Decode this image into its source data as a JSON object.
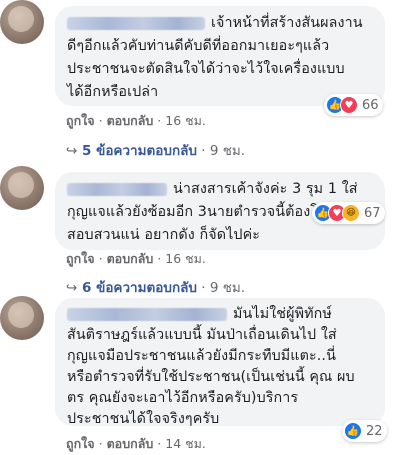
{
  "comments": [
    {
      "name_redacted": true,
      "text_lines": [
        "เจ้าหน้าที่สร้างสันผลงาน",
        "ดีๆอีกแล้วคับท่านดีคับดีที่ออกมาเยอะๆแล้ว",
        "ประชาชนจะตัดสินใจได้ว่าจะไว้ใจเครื่องแบบ",
        "ได้อีกหรือเปล่า"
      ],
      "reactions": [
        "like-icon",
        "love-icon"
      ],
      "reaction_count": "66",
      "like": "ถูกใจ",
      "reply": "ตอบกลับ",
      "time": "16 ชม.",
      "replies_label": "5 ข้อความตอบกลับ",
      "replies_time": "9 ชม."
    },
    {
      "name_redacted": true,
      "text_lines": [
        "น่าสงสารเค้าจังค่ะ 3 รุม 1 ใส่",
        "กุญแจแล้วยังซ้อมอีก 3นายตำรวจนี้ต้องโดน",
        "สอบสวนแน่ อยากดัง ก็จัดไปค่ะ"
      ],
      "reactions": [
        "like-icon",
        "love-icon",
        "haha-icon"
      ],
      "reaction_count": "67",
      "like": "ถูกใจ",
      "reply": "ตอบกลับ",
      "time": "16 ชม.",
      "replies_label": "6 ข้อความตอบกลับ",
      "replies_time": "9 ชม."
    },
    {
      "name_redacted": true,
      "text_lines": [
        "มันไม่ใช่ผู้พิทักษ์",
        "สันติราษฎร์แล้วแบบนี้ มันป่าเถื่อนเดินไป ใส่",
        "กุญแจมือประชาชนแล้วยังมีกระทืบมีแตะ..นี่",
        "หรือตำรวจที่รับใช้ประชาชน(เป็นเช่นนี้ คุณ ผบ",
        "ตร คุณยังจะเอาไว้อีกหรือครับ)บริการ",
        "ประชาชนได้ใจจริงๆครับ"
      ],
      "reactions": [
        "like-icon"
      ],
      "reaction_count": "22",
      "like": "ถูกใจ",
      "reply": "ตอบกลับ",
      "time": "14 ชม."
    }
  ],
  "colors": {
    "link": "#385898",
    "muted": "#65676b",
    "bubble": "#f2f3f5",
    "like": "#1877f2",
    "love": "#f33e58",
    "haha": "#f7b125"
  }
}
